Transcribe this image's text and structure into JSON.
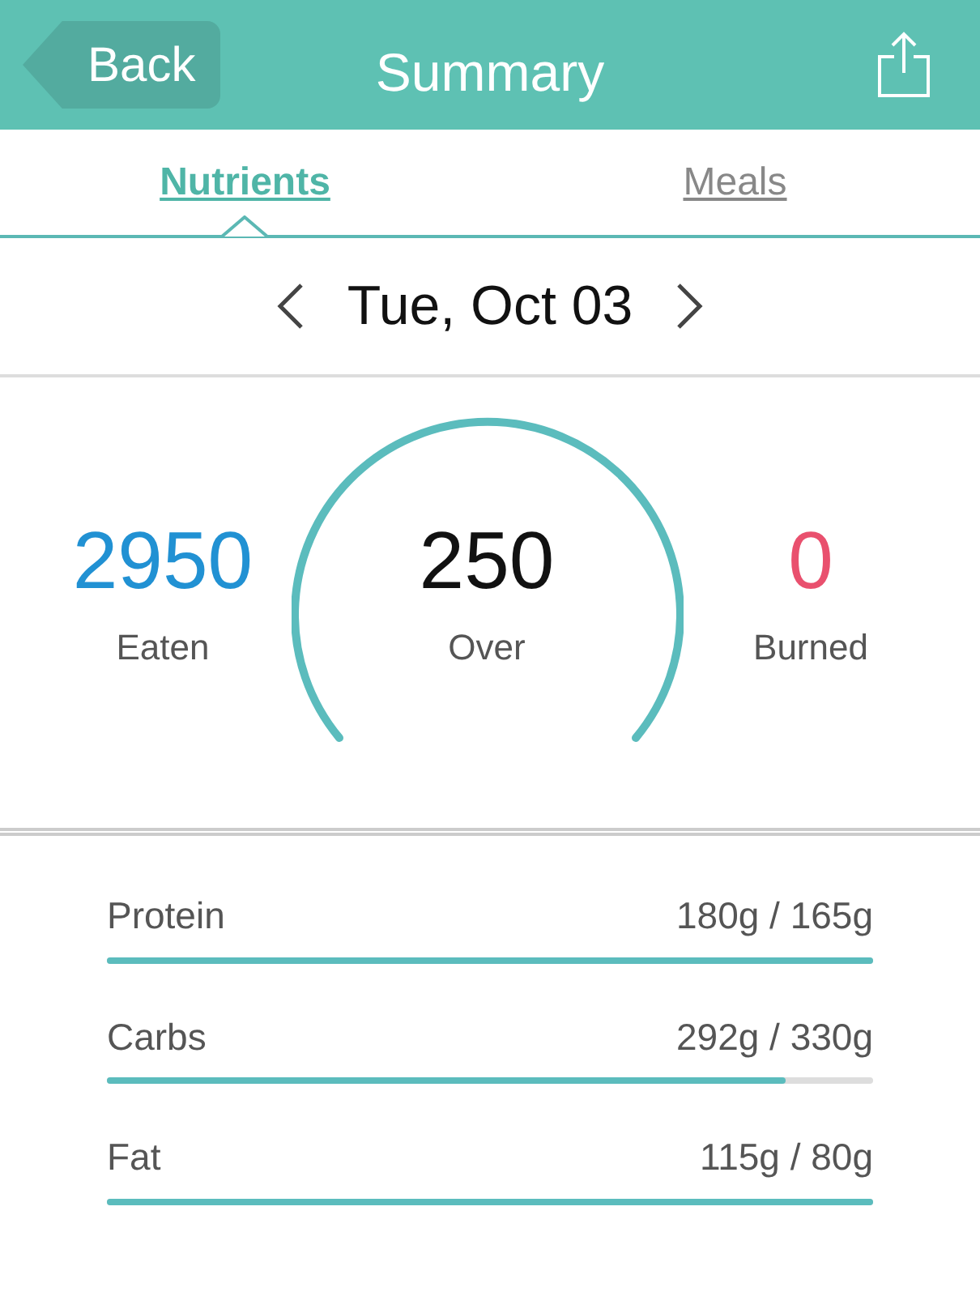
{
  "header": {
    "back": "Back",
    "title": "Summary"
  },
  "tabs": [
    {
      "label": "Nutrients",
      "selected": true
    },
    {
      "label": "Meals",
      "selected": false
    }
  ],
  "date": {
    "label": "Tue, Oct 03"
  },
  "calories": [
    {
      "kind": "side",
      "value": "2950",
      "label": "Eaten",
      "color": "#2191d3"
    },
    {
      "kind": "center",
      "value": "250",
      "label": "Over",
      "color": "#111111"
    },
    {
      "kind": "side",
      "value": "0",
      "label": "Burned",
      "color": "#e9506e"
    }
  ],
  "macros": [
    {
      "name": "Protein",
      "reading": "180g / 165g",
      "level": 1
    },
    {
      "name": "Carbs",
      "reading": "292g / 330g",
      "level": 0.885
    },
    {
      "name": "Fat",
      "reading": "115g / 80g",
      "level": 1
    }
  ]
}
